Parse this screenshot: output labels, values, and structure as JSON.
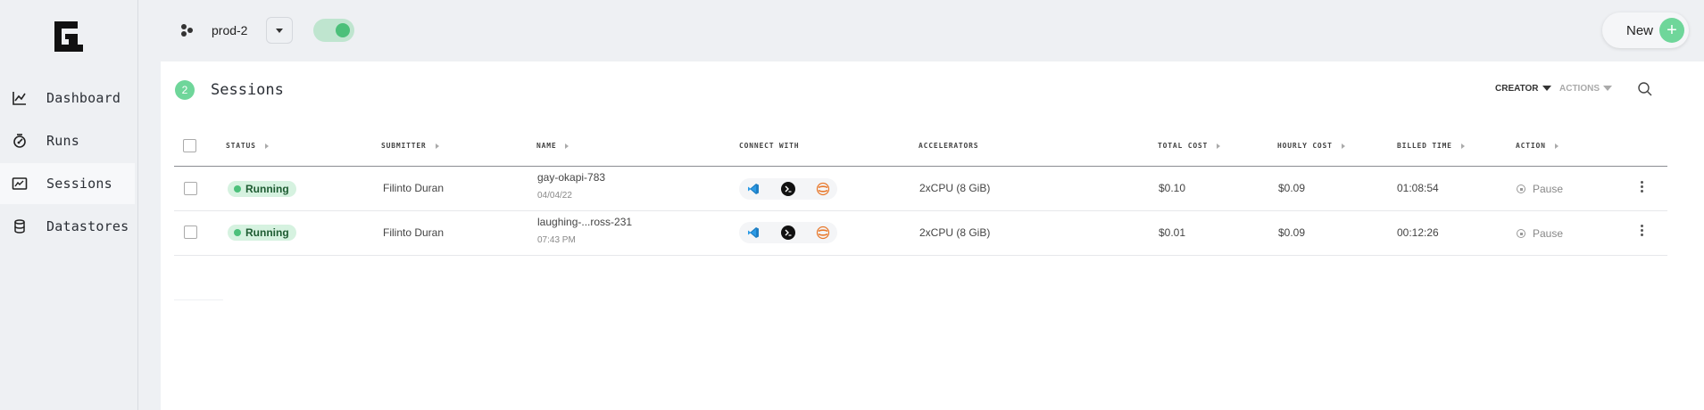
{
  "sidebar": {
    "logo": "G",
    "items": [
      {
        "label": "Dashboard",
        "icon": "chart-line-icon"
      },
      {
        "label": "Runs",
        "icon": "runs-icon"
      },
      {
        "label": "Sessions",
        "icon": "terminal-chart-icon",
        "active": true
      },
      {
        "label": "Datastores",
        "icon": "database-icon"
      }
    ]
  },
  "topbar": {
    "project_name": "prod-2",
    "toggle_on": true,
    "new_label": "New",
    "new_icon": "+"
  },
  "panel": {
    "count": "2",
    "title": "Sessions",
    "filter_creator": "CREATOR",
    "filter_actions": "ACTIONS"
  },
  "table": {
    "headers": {
      "status": "STATUS",
      "submitter": "SUBMITTER",
      "name": "NAME",
      "connect": "CONNECT WITH",
      "accelerators": "ACCELERATORS",
      "total_cost": "TOTAL COST",
      "hourly_cost": "HOURLY COST",
      "billed_time": "BILLED TIME",
      "action": "ACTION"
    },
    "rows": [
      {
        "status": "Running",
        "submitter": "Filinto Duran",
        "name": "gay-okapi-783",
        "sub": "04/04/22",
        "accelerators": "2xCPU (8 GiB)",
        "total_cost": "$0.10",
        "hourly_cost": "$0.09",
        "billed_time": "01:08:54",
        "action": "Pause"
      },
      {
        "status": "Running",
        "submitter": "Filinto Duran",
        "name": "laughing-...ross-231",
        "sub": "07:43 PM",
        "accelerators": "2xCPU (8 GiB)",
        "total_cost": "$0.01",
        "hourly_cost": "$0.09",
        "billed_time": "00:12:26",
        "action": "Pause"
      }
    ]
  },
  "colors": {
    "accent_green": "#6fd69a",
    "status_bg": "#d6f2e0",
    "status_dot": "#4cc07a",
    "vscode_blue": "#1f7fc4",
    "jupyter_orange": "#e8782b"
  }
}
